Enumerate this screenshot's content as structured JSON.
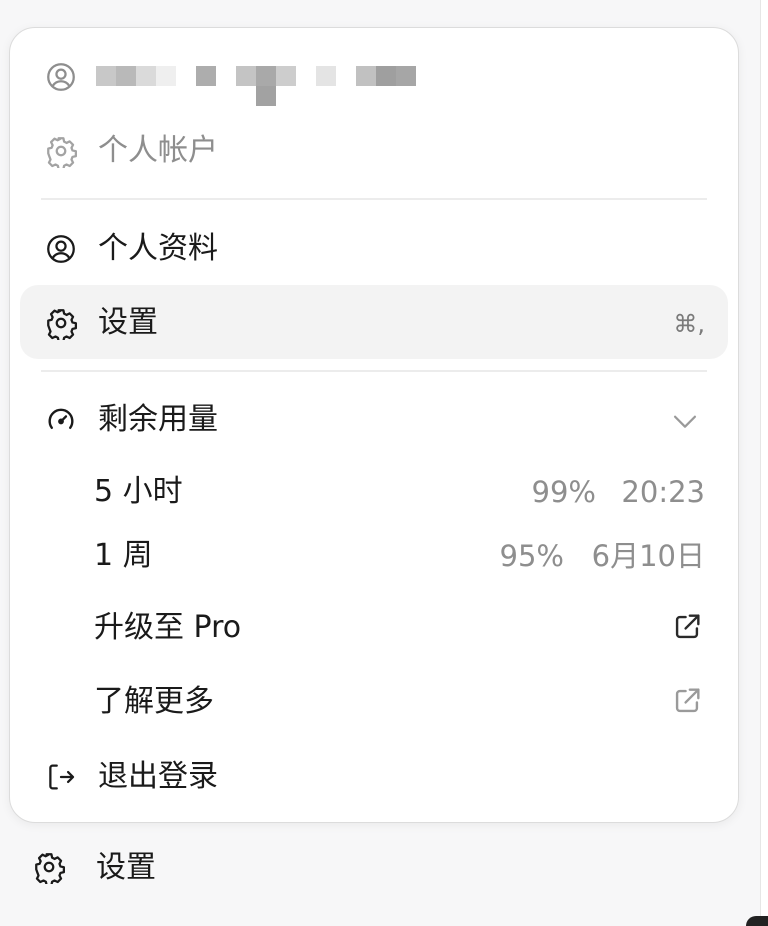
{
  "menu": {
    "account_label": "个人帐户",
    "profile_label": "个人资料",
    "settings_label": "设置",
    "settings_shortcut": "⌘,",
    "usage": {
      "title": "剩余用量",
      "rows": [
        {
          "label": "5 小时",
          "percent": "99%",
          "reset": "20:23"
        },
        {
          "label": "1 周",
          "percent": "95%",
          "reset": "6月10日"
        }
      ]
    },
    "upgrade_label": "升级至 Pro",
    "learn_more_label": "了解更多",
    "logout_label": "退出登录"
  },
  "footer": {
    "settings_label": "设置"
  },
  "icons": {
    "user": "user-circle-icon",
    "gear": "gear-icon",
    "gauge": "gauge-icon",
    "chevron": "chevron-down-icon",
    "external": "external-link-icon",
    "logout": "logout-icon"
  },
  "colors": {
    "muted": "#8e8e8e",
    "highlight": "#f3f3f3",
    "text": "#1a1a1a"
  }
}
